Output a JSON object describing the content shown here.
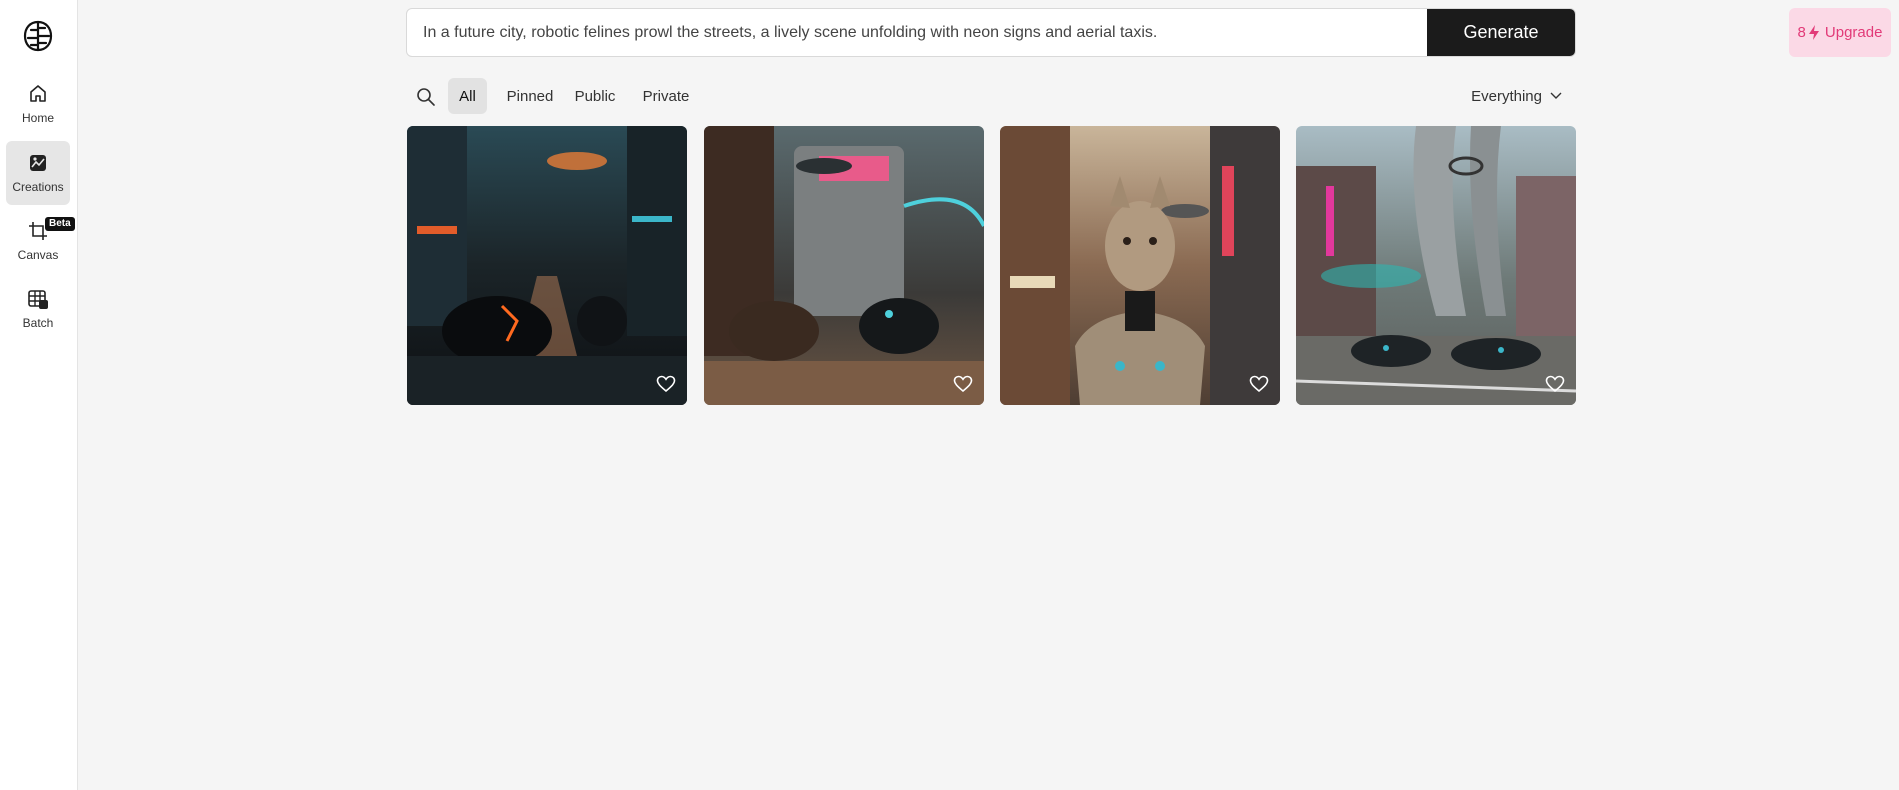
{
  "sidebar": {
    "items": [
      {
        "label": "Home",
        "icon": "home-icon"
      },
      {
        "label": "Creations",
        "icon": "creations-icon"
      },
      {
        "label": "Canvas",
        "icon": "canvas-icon",
        "badge": "Beta"
      },
      {
        "label": "Batch",
        "icon": "batch-icon"
      }
    ],
    "active": "Creations"
  },
  "prompt": {
    "value": "In a future city, robotic felines prowl the streets, a lively scene unfolding with neon signs and aerial taxis.",
    "generate_label": "Generate"
  },
  "upgrade": {
    "credits": "8",
    "label": "Upgrade",
    "icon": "lightning-icon",
    "color": "#e23a78"
  },
  "filters": {
    "tabs": [
      "All",
      "Pinned",
      "Public",
      "Private"
    ],
    "active_tab": "All",
    "dropdown_value": "Everything"
  },
  "gallery": {
    "images": [
      {
        "alt": "robot panthers on wet neon street",
        "favorite_icon": "heart-icon"
      },
      {
        "alt": "robotic cats near curved neon building",
        "favorite_icon": "heart-icon"
      },
      {
        "alt": "humanoid robot cat on city street",
        "favorite_icon": "heart-icon"
      },
      {
        "alt": "robot panthers crossing street with flying taxis",
        "favorite_icon": "heart-icon"
      }
    ]
  },
  "colors": {
    "accent_dark": "#1b1b1b",
    "upgrade_bg": "#fbd9e6",
    "active_tab_bg": "#e2e2e2"
  }
}
